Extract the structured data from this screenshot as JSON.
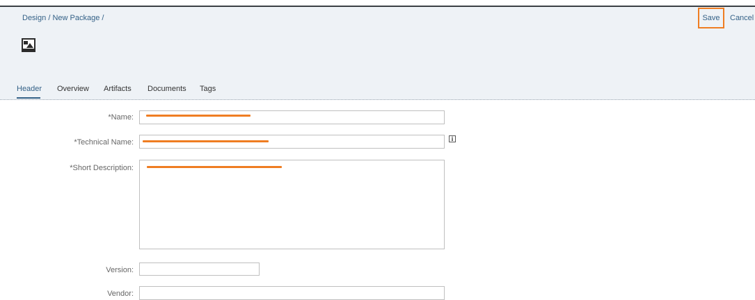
{
  "breadcrumb": {
    "items": [
      "Design",
      "New Package"
    ],
    "separator": "/"
  },
  "toolbar": {
    "save_label": "Save",
    "cancel_label": "Cancel"
  },
  "tabs": [
    {
      "label": "Header",
      "active": true
    },
    {
      "label": "Overview",
      "active": false
    },
    {
      "label": "Artifacts",
      "active": false
    },
    {
      "label": "Documents",
      "active": false
    },
    {
      "label": "Tags",
      "active": false
    }
  ],
  "form": {
    "name_label": "*Name:",
    "name_value": "",
    "technical_name_label": "*Technical Name:",
    "technical_name_value": "",
    "short_description_label": "*Short Description:",
    "short_description_value": "",
    "version_label": "Version:",
    "version_value": "",
    "vendor_label": "Vendor:",
    "vendor_value": ""
  },
  "icons": {
    "package": "image-icon",
    "info": "info-icon"
  },
  "colors": {
    "accent": "#346187",
    "highlight": "#ef7d22",
    "header_bg": "#eef2f6"
  }
}
